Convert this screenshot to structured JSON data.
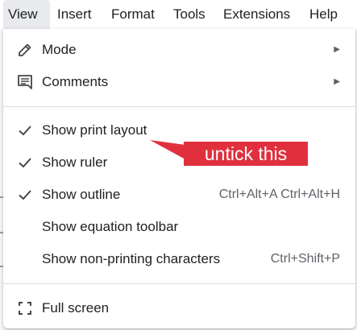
{
  "menubar": {
    "items": [
      {
        "label": "View"
      },
      {
        "label": "Insert"
      },
      {
        "label": "Format"
      },
      {
        "label": "Tools"
      },
      {
        "label": "Extensions"
      },
      {
        "label": "Help"
      }
    ]
  },
  "menu": {
    "mode": {
      "label": "Mode",
      "icon": "pencil-icon",
      "has_submenu": true
    },
    "comments": {
      "label": "Comments",
      "icon": "comment-icon",
      "has_submenu": true
    },
    "show_print_layout": {
      "label": "Show print layout",
      "checked": true
    },
    "show_ruler": {
      "label": "Show ruler",
      "checked": true
    },
    "show_outline": {
      "label": "Show outline",
      "checked": true,
      "shortcut": "Ctrl+Alt+A Ctrl+Alt+H"
    },
    "show_equation_toolbar": {
      "label": "Show equation toolbar",
      "checked": false
    },
    "show_non_printing": {
      "label": "Show non-printing characters",
      "checked": false,
      "shortcut": "Ctrl+Shift+P"
    },
    "full_screen": {
      "label": "Full screen",
      "icon": "fullscreen-icon"
    }
  },
  "annotation": {
    "text": "untick this",
    "color": "#e0303e"
  },
  "colors": {
    "text": "#202124",
    "shortcut": "#5f6368",
    "divider": "#dadce0",
    "active_menu_bg": "#e8eaed"
  }
}
